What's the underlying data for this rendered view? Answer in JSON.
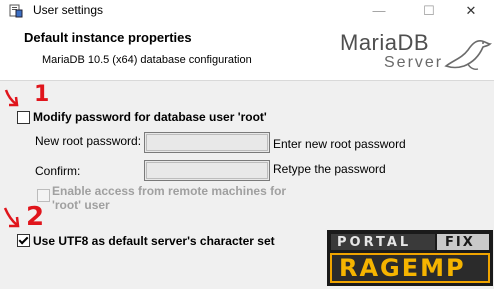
{
  "window": {
    "title": "User settings",
    "minimize_glyph": "—",
    "maximize_glyph": "☐",
    "close_glyph": "✕",
    "icon": "installer-app-icon"
  },
  "header": {
    "title": "Default instance properties",
    "subtitle": "MariaDB 10.5 (x64) database configuration",
    "logo_main": "MariaDB",
    "logo_sub": "Server"
  },
  "form": {
    "modify_password": {
      "label": "Modify password for database user 'root'",
      "checked": false
    },
    "new_password": {
      "label": "New root password:",
      "hint": "Enter new root password",
      "value": ""
    },
    "confirm": {
      "label": "Confirm:",
      "hint": "Retype the password",
      "value": ""
    },
    "remote_access": {
      "label_line1": "Enable access from remote machines for",
      "label_line2": "'root' user",
      "checked": false,
      "enabled": false
    },
    "utf8": {
      "label": "Use UTF8 as default server's character set",
      "checked": true
    }
  },
  "annotations": {
    "marker_1": "1",
    "marker_2": "2",
    "color": "#e0151c"
  },
  "watermark": {
    "line1_left": "PORTAL",
    "line1_right": "FIX",
    "line2": "RAGEMP"
  }
}
